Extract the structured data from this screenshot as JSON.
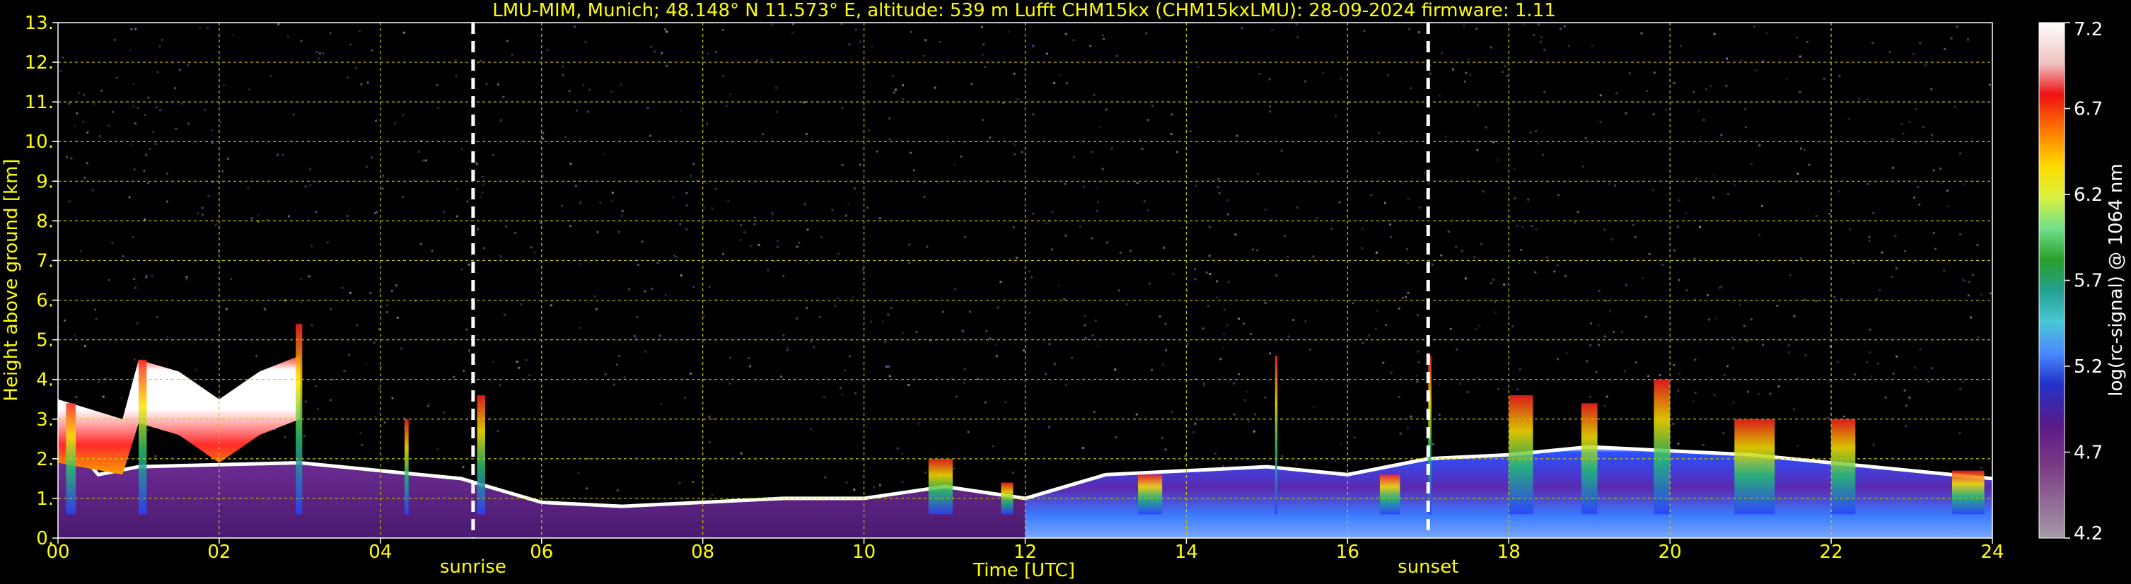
{
  "chart_data": {
    "type": "heatmap",
    "title": "LMU-MIM, Munich; 48.148° N 11.573° E, altitude: 539 m    Lufft CHM15kx (CHM15kxLMU): 28-09-2024    firmware: 1.11",
    "xlabel": "Time [UTC]",
    "ylabel": "Height above ground [km]",
    "colorbar_label": "log(rc-signal) @ 1064 nm",
    "xlim": [
      0,
      24
    ],
    "ylim": [
      0,
      13
    ],
    "x_tick_labels": [
      "00",
      "02",
      "04",
      "06",
      "08",
      "10",
      "12",
      "14",
      "16",
      "18",
      "20",
      "22",
      "24"
    ],
    "y_tick_labels": [
      "0.",
      "1.",
      "2.",
      "3.",
      "4.",
      "5.",
      "6.",
      "7.",
      "8.",
      "9.",
      "10.",
      "11.",
      "12.",
      "13."
    ],
    "colorbar_range": [
      4.2,
      7.2
    ],
    "colorbar_tick_labels": [
      "4.2",
      "4.7",
      "5.2",
      "5.7",
      "6.2",
      "6.7",
      "7.2"
    ],
    "grid": true,
    "markers": [
      {
        "label": "sunrise",
        "time": 5.15
      },
      {
        "label": "sunset",
        "time": 17.0
      }
    ],
    "boundary_layer_top_km": [
      [
        0.0,
        2.8
      ],
      [
        0.5,
        1.6
      ],
      [
        1.0,
        1.8
      ],
      [
        3.0,
        1.9
      ],
      [
        4.0,
        1.7
      ],
      [
        5.0,
        1.5
      ],
      [
        6.0,
        0.9
      ],
      [
        7.0,
        0.8
      ],
      [
        8.0,
        0.9
      ],
      [
        9.0,
        1.0
      ],
      [
        10.0,
        1.0
      ],
      [
        11.0,
        1.3
      ],
      [
        12.0,
        1.0
      ],
      [
        13.0,
        1.6
      ],
      [
        14.0,
        1.7
      ],
      [
        15.0,
        1.8
      ],
      [
        16.0,
        1.6
      ],
      [
        17.0,
        2.0
      ],
      [
        18.0,
        2.1
      ],
      [
        19.0,
        2.3
      ],
      [
        20.0,
        2.2
      ],
      [
        21.0,
        2.1
      ],
      [
        22.0,
        1.9
      ],
      [
        23.0,
        1.7
      ],
      [
        24.0,
        1.5
      ]
    ],
    "aerosol_layer_top_km": [
      [
        0.0,
        3.5
      ],
      [
        0.8,
        3.0
      ],
      [
        1.0,
        4.5
      ],
      [
        1.5,
        4.2
      ],
      [
        2.0,
        3.5
      ],
      [
        2.5,
        4.2
      ],
      [
        3.0,
        4.6
      ]
    ],
    "colors": {
      "background": "#000000",
      "axis_text": "#ffff00",
      "grid": "#c8c800",
      "markers": "#ffffff"
    }
  }
}
